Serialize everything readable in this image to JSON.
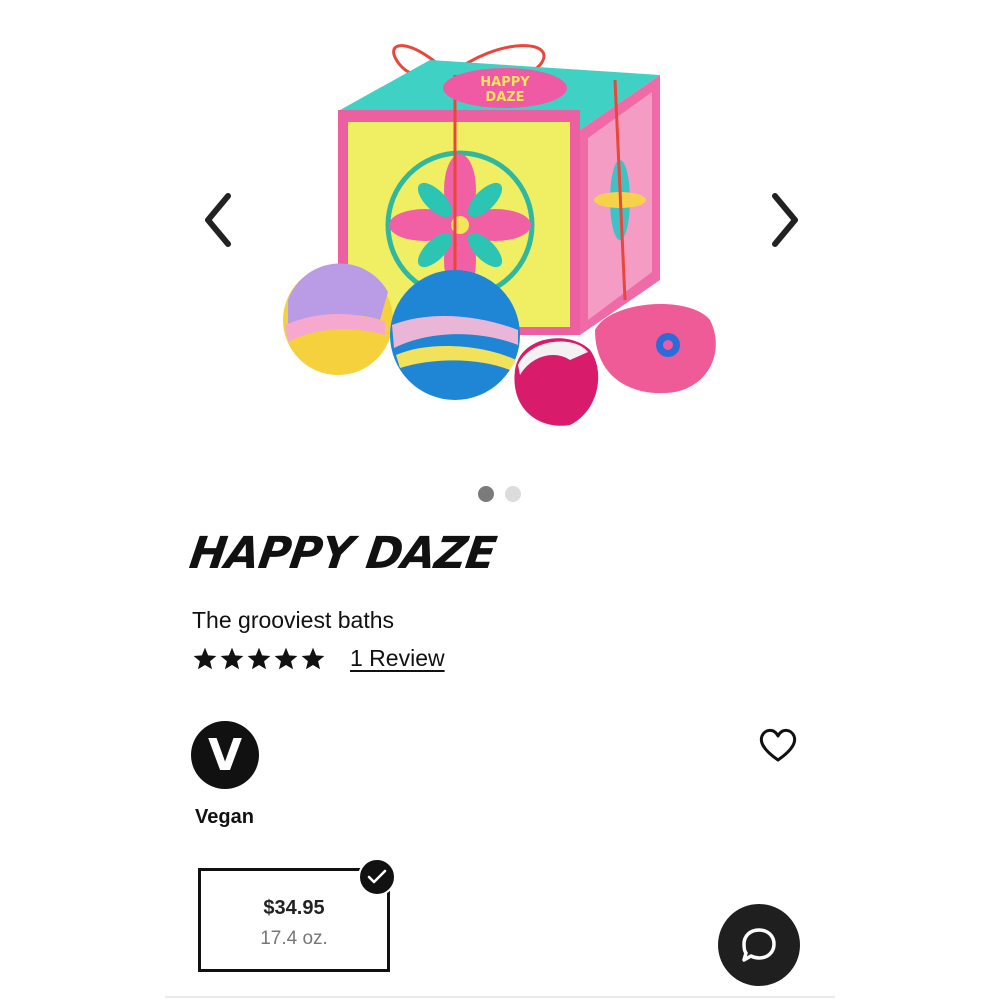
{
  "product": {
    "name": "HAPPY DAZE",
    "tagline": "The grooviest baths",
    "rating_stars": 5,
    "review_link": "1 Review",
    "image_box_label_line1": "HAPPY",
    "image_box_label_line2": "DAZE"
  },
  "carousel": {
    "prev_icon": "chevron-left-icon",
    "next_icon": "chevron-right-icon",
    "slide_count": 2,
    "active_slide": 1
  },
  "badges": {
    "vegan_letter": "V",
    "vegan_label": "Vegan"
  },
  "size_options": [
    {
      "price": "$34.95",
      "weight": "17.4 oz.",
      "selected": true
    }
  ],
  "icons": {
    "wishlist": "heart-outline-icon",
    "chat": "chat-bubble-icon",
    "selected": "checkmark-icon"
  },
  "colors": {
    "text": "#111111",
    "dot_active": "#7b7b7b",
    "dot_inactive": "#dcdcdc",
    "chat_bg": "#1f1f1f",
    "price_text": "#222222",
    "weight_text": "#777777"
  }
}
